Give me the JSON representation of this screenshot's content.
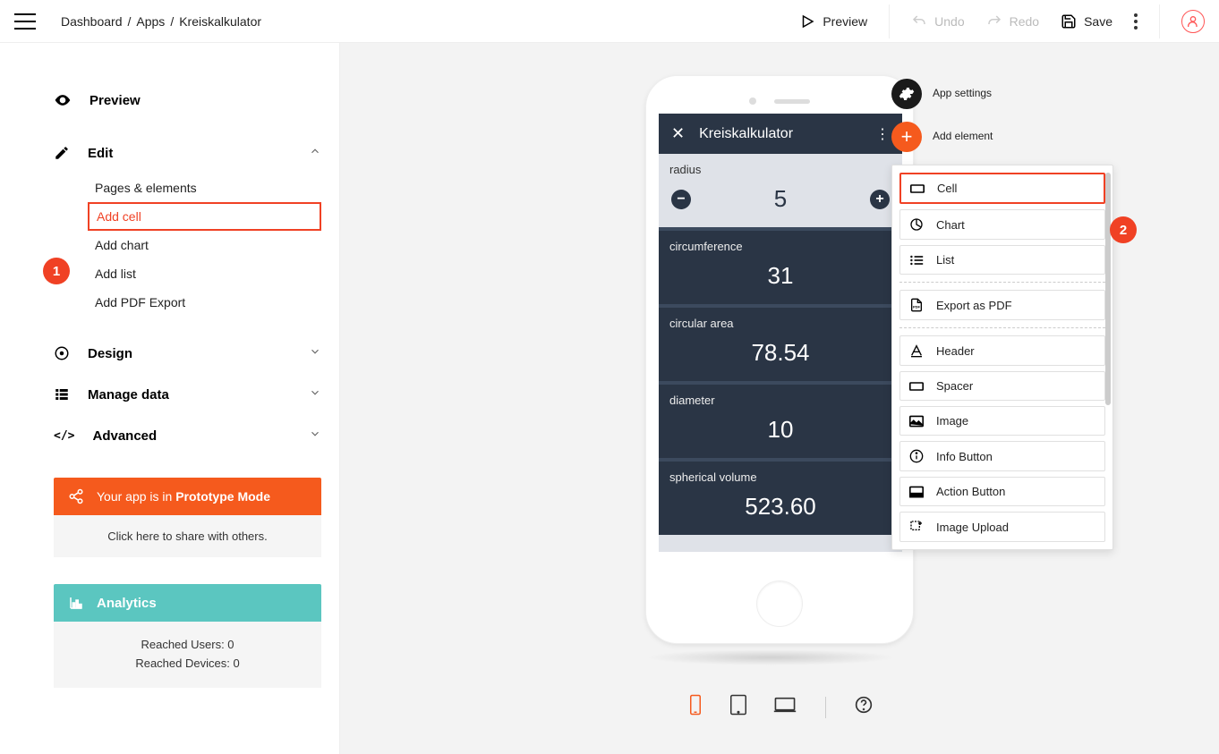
{
  "breadcrumb": {
    "a": "Dashboard",
    "b": "Apps",
    "c": "Kreiskalkulator"
  },
  "header": {
    "preview": "Preview",
    "undo": "Undo",
    "redo": "Redo",
    "save": "Save"
  },
  "sidebar": {
    "preview": "Preview",
    "edit": "Edit",
    "subs": {
      "pages": "Pages & elements",
      "addcell": "Add cell",
      "addchart": "Add chart",
      "addlist": "Add list",
      "addpdf": "Add PDF Export"
    },
    "design": "Design",
    "manage": "Manage data",
    "advanced": "Advanced"
  },
  "promo": {
    "prefix": "Your app is in ",
    "bold": "Prototype Mode",
    "share": "Click here to share with others."
  },
  "analytics": {
    "title": "Analytics",
    "users": "Reached Users: 0",
    "devices": "Reached Devices: 0"
  },
  "callouts": {
    "one": "1",
    "two": "2"
  },
  "app": {
    "title": "Kreiskalkulator",
    "cells": {
      "radius": {
        "label": "radius",
        "value": "5"
      },
      "circ": {
        "label": "circumference",
        "value": "31"
      },
      "area": {
        "label": "circular area",
        "value": "78.54"
      },
      "diam": {
        "label": "diameter",
        "value": "10"
      },
      "vol": {
        "label": "spherical volume",
        "value": "523.60"
      }
    }
  },
  "rpanel": {
    "settings": "App settings",
    "add": "Add element",
    "items": {
      "cell": "Cell",
      "chart": "Chart",
      "list": "List",
      "pdf": "Export as PDF",
      "header": "Header",
      "spacer": "Spacer",
      "image": "Image",
      "info": "Info Button",
      "action": "Action Button",
      "upload": "Image Upload"
    }
  }
}
